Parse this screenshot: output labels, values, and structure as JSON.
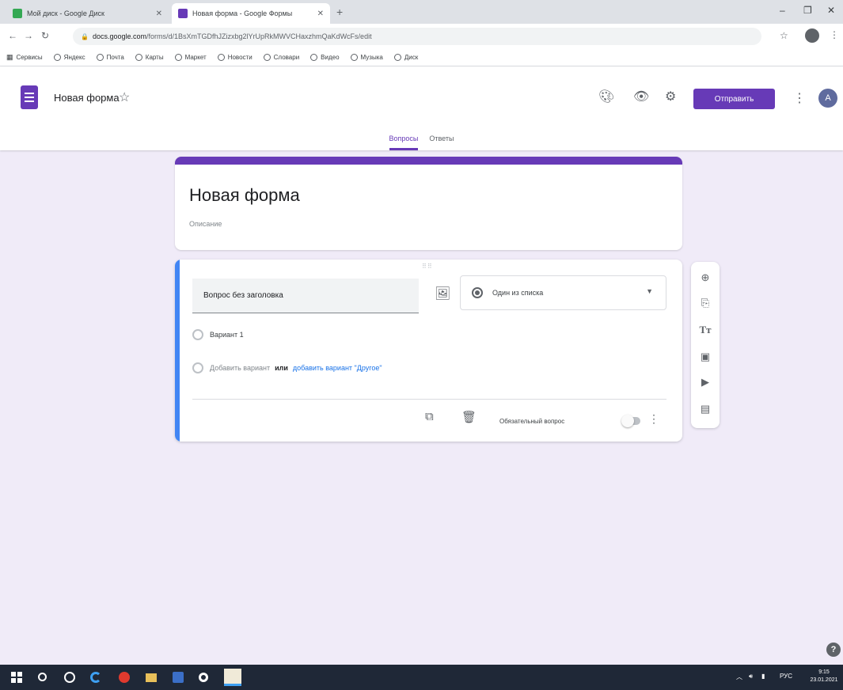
{
  "browser": {
    "tabs": [
      {
        "title": "Мой диск - Google Диск",
        "active": false,
        "favicon_color": "#34a853"
      },
      {
        "title": "Новая форма - Google Формы",
        "active": true,
        "favicon_color": "#673ab7"
      }
    ],
    "new_tab": "+",
    "window_controls": {
      "minimize": "–",
      "maximize": "❐",
      "close": "✕"
    },
    "url_domain": "docs.google.com",
    "url_path": "/forms/d/1BsXmTGDfhJZizxbg2lYrUpRkMWVCHaxzhmQaKdWcFs/edit",
    "bookmarks": [
      "Сервисы",
      "Яндекс",
      "Почта",
      "Карты",
      "Маркет",
      "Новости",
      "Словари",
      "Видео",
      "Музыка",
      "Диск"
    ]
  },
  "header": {
    "doc_title": "Новая форма",
    "send_label": "Отправить",
    "avatar_letter": "A",
    "tabs": [
      "Вопросы",
      "Ответы"
    ]
  },
  "title_card": {
    "title": "Новая форма",
    "description_placeholder": "Описание"
  },
  "question": {
    "title": "Вопрос без заголовка",
    "type": "Один из списка",
    "option_1": "Вариант 1",
    "add_option": "Добавить вариант",
    "or_text": "или",
    "add_other": "добавить вариант \"Другое\"",
    "required_label": "Обязательный вопрос"
  },
  "side_tools": [
    "add-question-icon",
    "import-icon",
    "add-title-icon",
    "add-image-icon",
    "add-video-icon",
    "add-section-icon"
  ],
  "taskbar": {
    "lang": "РУС",
    "time": "9:15",
    "date": "23.01.2021"
  },
  "colors": {
    "accent": "#673ab7",
    "background": "#f0ebf8",
    "question_focus": "#4285f4"
  }
}
